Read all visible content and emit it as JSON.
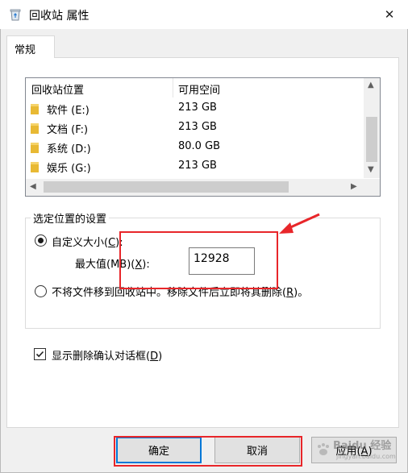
{
  "window": {
    "title": "回收站 属性",
    "close_glyph": "✕"
  },
  "tab": {
    "label": "常规"
  },
  "list": {
    "col_location": "回收站位置",
    "col_space": "可用空间",
    "rows": [
      {
        "name": "软件 (E:)",
        "space": "213 GB"
      },
      {
        "name": "文档 (F:)",
        "space": "213 GB"
      },
      {
        "name": "系统 (D:)",
        "space": "80.0 GB"
      },
      {
        "name": "娱乐 (G:)",
        "space": "213 GB"
      }
    ]
  },
  "settings": {
    "group_label": "选定位置的设置",
    "custom_size_prefix": "自定义大小(",
    "custom_size_key": "C",
    "custom_size_suffix": "):",
    "max_value_prefix": "最大值(MB)(",
    "max_value_key": "X",
    "max_value_suffix": "):",
    "max_value": "12928",
    "no_recycle_prefix": "不将文件移到回收站中。移除文件后立即将其删除(",
    "no_recycle_key": "R",
    "no_recycle_suffix": ")。",
    "custom_selected": true
  },
  "confirm": {
    "label_prefix": "显示删除确认对话框(",
    "label_key": "D",
    "label_suffix": ")",
    "checked": true
  },
  "buttons": {
    "ok": "确定",
    "cancel": "取消",
    "apply_prefix": "应用(",
    "apply_key": "A",
    "apply_suffix": ")"
  },
  "watermark": {
    "text": "Baidu 经验",
    "sub": "jingyan.baidu.com"
  },
  "colors": {
    "accent": "#0078d7",
    "annotation": "#e8262a",
    "folder": "#e8b934"
  }
}
